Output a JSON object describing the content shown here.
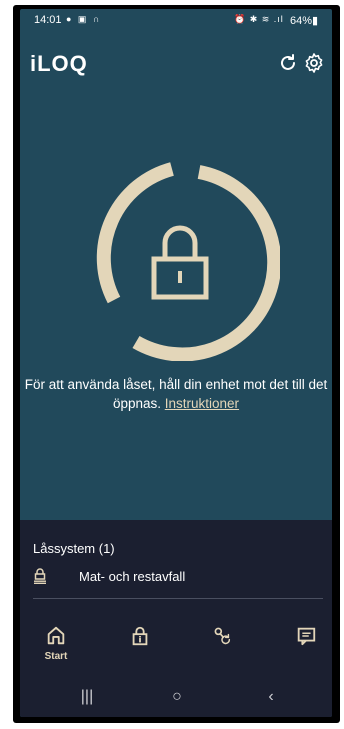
{
  "status_bar": {
    "time": "14:01",
    "left_icons": "● ▣ ∩",
    "right_icons": "⏰ ✱ ≋ .ıl",
    "battery": "64%▮"
  },
  "header": {
    "logo": "iLOQ",
    "refresh_icon": "refresh-icon",
    "settings_icon": "gear-icon"
  },
  "main": {
    "instruction_text": "För att använda låset, håll din enhet mot det till det öppnas.",
    "instruction_link": "Instruktioner"
  },
  "lock_systems": {
    "title": "Låssystem (1)",
    "items": [
      {
        "label": "Mat- och restavfall",
        "icon": "lock-system-icon"
      }
    ]
  },
  "bottom_nav": {
    "items": [
      {
        "label": "Start",
        "icon": "home-icon",
        "active": true
      },
      {
        "label": "",
        "icon": "lock-info-icon"
      },
      {
        "label": "",
        "icon": "key-sync-icon"
      },
      {
        "label": "",
        "icon": "message-icon"
      }
    ]
  },
  "system_nav": {
    "recents": "|||",
    "home": "○",
    "back": "‹"
  },
  "colors": {
    "background": "#21495b",
    "accent": "#e3d6b9",
    "panel": "#1b1f30"
  }
}
